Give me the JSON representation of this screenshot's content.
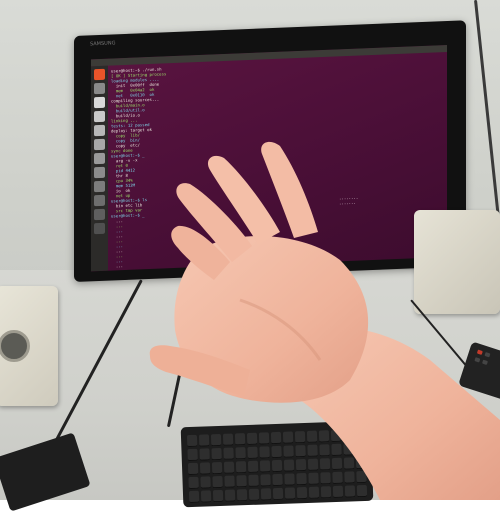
{
  "scene": {
    "description_tags": [
      "monitor",
      "hand",
      "keyboard",
      "speakers"
    ]
  },
  "monitor": {
    "brand": "SAMSUNG",
    "screen": {
      "topbar_title": "",
      "topbar_info": "",
      "terminal_lines": [
        "user@host:~$ ./run.sh",
        "[ OK ] Starting process",
        "loading modules ....",
        "  init  0x00ff  done",
        "  mem   0x04a2  ok",
        "  net   0x0110  ok",
        "compiling sources...",
        "  build/main.o",
        "  build/util.o",
        "  build/io.o",
        "linking ...",
        "tests: 12 passed",
        "deploy: target ok",
        "  copy  lib/",
        "  copy  bin/",
        "  copy  etc/",
        "sync done",
        "user@host:~$ _",
        "  arg -v -x",
        "  ret 0",
        "  pid 4412",
        "  thr 8",
        "  cpu 34%",
        "  mem 512M",
        "  io  ok",
        "  net up",
        "user@host:~$ ls",
        "  bin etc lib",
        "  src tmp var",
        "user@host:~$ _",
        "  ...",
        "  ...",
        "  ...",
        "  ...",
        "  ...",
        "  ...",
        "  ...",
        "  ...",
        "  ...",
        "  ..."
      ],
      "side_text": [
        "........",
        "......."
      ],
      "launcher_icons": [
        "#e9542a",
        "#8a8a8a",
        "#d9d9d9",
        "#c9c9c9",
        "#b7b7b7",
        "#a8a8a8",
        "#9a9a9a",
        "#8c8c8c",
        "#7d7d7d",
        "#6e6e6e",
        "#5f5f5f",
        "#505050"
      ]
    }
  },
  "colors": {
    "screen_purple": "#4a0f37",
    "terminal_green": "#9be06a",
    "terminal_white": "#e9e4dc",
    "terminal_cyan": "#7fd3e6",
    "skin": "#f2b7a1"
  },
  "gadget": {
    "label": ""
  }
}
